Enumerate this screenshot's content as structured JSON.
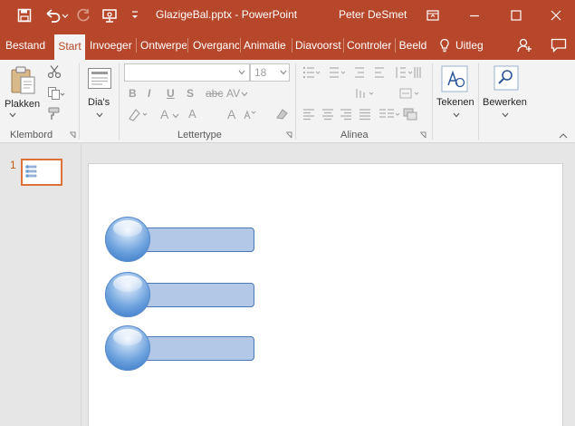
{
  "window": {
    "title": "GlazigeBal.pptx - PowerPoint",
    "user": "Peter DeSmet"
  },
  "colors": {
    "accent": "#b7472a",
    "selection": "#e0703a",
    "bar_fill": "#b3c7e7",
    "bar_border": "#4a79b5",
    "ball": "#4a86cf"
  },
  "tabs": [
    {
      "label": "Bestand"
    },
    {
      "label": "Start"
    },
    {
      "label": "Invoeger"
    },
    {
      "label": "Ontwerpe"
    },
    {
      "label": "Overganc"
    },
    {
      "label": "Animatie"
    },
    {
      "label": "Diavoorst"
    },
    {
      "label": "Controler"
    },
    {
      "label": "Beeld"
    },
    {
      "label": "Uitleg"
    }
  ],
  "ribbon": {
    "plakken": "Plakken",
    "klembord": "Klembord",
    "dias": "Dia's",
    "lettertype": "Lettertype",
    "font_name": "",
    "font_size": "18",
    "alinea": "Alinea",
    "tekenen": "Tekenen",
    "bewerken": "Bewerken",
    "bold": "B",
    "italic": "I",
    "underline": "U",
    "strike": "S",
    "abc": "abc",
    "av": "AV",
    "font_grow": "A",
    "font_shrink": "A",
    "clear": "A"
  },
  "thumbnails": {
    "slide_number": "1"
  },
  "icons": [
    "save-icon",
    "undo-icon",
    "redo-icon",
    "start-presentation-icon",
    "customize-qat-icon",
    "ribbon-display-icon",
    "minimize-icon",
    "maximize-icon",
    "close-icon",
    "lightbulb-icon",
    "share-icon",
    "comment-icon",
    "paste-icon",
    "cut-icon",
    "copy-icon",
    "format-painter-icon",
    "new-slide-icon",
    "draw-icon",
    "find-icon"
  ]
}
